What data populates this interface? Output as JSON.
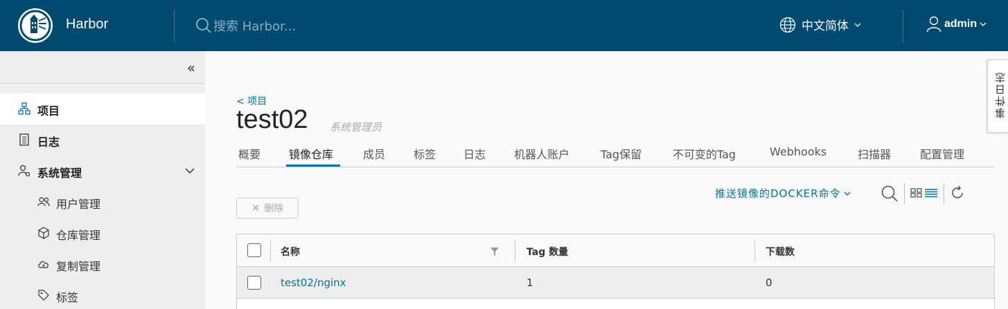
{
  "header": {
    "brand": "Harbor",
    "search_placeholder": "搜索 Harbor...",
    "language": "中文简体",
    "user": "admin"
  },
  "sidebar": {
    "items": [
      {
        "label": "项目",
        "icon": "project-icon",
        "active": true
      },
      {
        "label": "日志",
        "icon": "log-icon"
      },
      {
        "label": "系统管理",
        "icon": "admin-icon",
        "expanded": true
      }
    ],
    "sub_items": [
      {
        "label": "用户管理",
        "icon": "users-icon"
      },
      {
        "label": "仓库管理",
        "icon": "box-icon"
      },
      {
        "label": "复制管理",
        "icon": "cloud-icon"
      },
      {
        "label": "标签",
        "icon": "tag-icon"
      }
    ]
  },
  "events_tab": "事件日志",
  "project": {
    "back_link": "< 项目",
    "name": "test02",
    "role": "系统管理员"
  },
  "tabs": [
    "概要",
    "镜像仓库",
    "成员",
    "标签",
    "日志",
    "机器人账户",
    "Tag保留",
    "不可变的Tag",
    "Webhooks",
    "扫描器",
    "配置管理"
  ],
  "active_tab": "镜像仓库",
  "toolbar": {
    "push_command": "推送镜像的DOCKER命令",
    "delete_label": "删除"
  },
  "table": {
    "columns": [
      "名称",
      "Tag 数量",
      "下载数"
    ],
    "rows": [
      {
        "name": "test02/nginx",
        "tags": "1",
        "pulls": "0"
      }
    ]
  },
  "colors": {
    "header_bg": "#004a70",
    "accent": "#0072a3",
    "sidebar_bg": "#eeeeee"
  }
}
